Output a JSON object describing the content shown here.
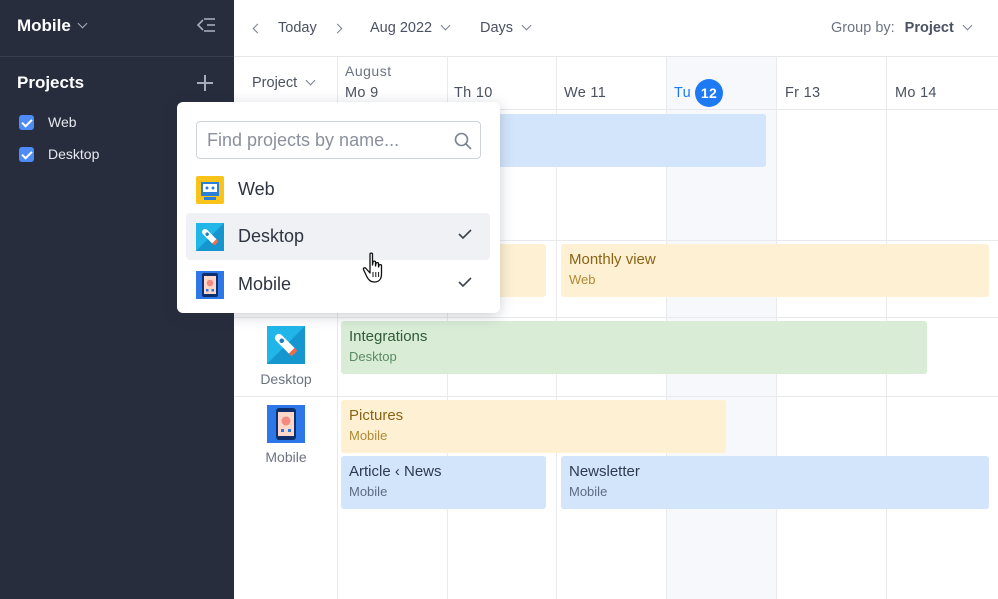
{
  "sidebar": {
    "workspace": "Mobile",
    "section_title": "Projects",
    "items": [
      {
        "label": "Web",
        "checked": true
      },
      {
        "label": "Desktop",
        "checked": true
      }
    ]
  },
  "toolbar": {
    "today": "Today",
    "period": "Aug 2022",
    "view": "Days",
    "group_by_label": "Group by:",
    "group_by_value": "Project"
  },
  "grid": {
    "row_header": "Project",
    "month": "August",
    "days": [
      "Mo 9",
      "Th 10",
      "We 11",
      "Tu",
      "Fr 13",
      "Mo 14"
    ],
    "today_number": "12"
  },
  "rows": [
    {
      "project": "Desktop"
    },
    {
      "project": "Mobile"
    }
  ],
  "events": {
    "monthly_view": {
      "title": "Monthly view",
      "project": "Web"
    },
    "integrations": {
      "title": "Integrations",
      "project": "Desktop"
    },
    "pictures": {
      "title": "Pictures",
      "project": "Mobile"
    },
    "article_news": {
      "title": "Article ‹ News",
      "project": "Mobile"
    },
    "newsletter": {
      "title": "Newsletter",
      "project": "Mobile"
    }
  },
  "dropdown": {
    "placeholder": "Find projects by name...",
    "options": [
      {
        "label": "Web",
        "checked": false
      },
      {
        "label": "Desktop",
        "checked": true
      },
      {
        "label": "Mobile",
        "checked": true
      }
    ]
  },
  "colors": {
    "sidebar_bg": "#272d3d",
    "accent": "#1d7af3",
    "event_blue": "#d3e5fb",
    "event_yellow": "#fdf0d3",
    "event_green": "#d8ecd6"
  }
}
